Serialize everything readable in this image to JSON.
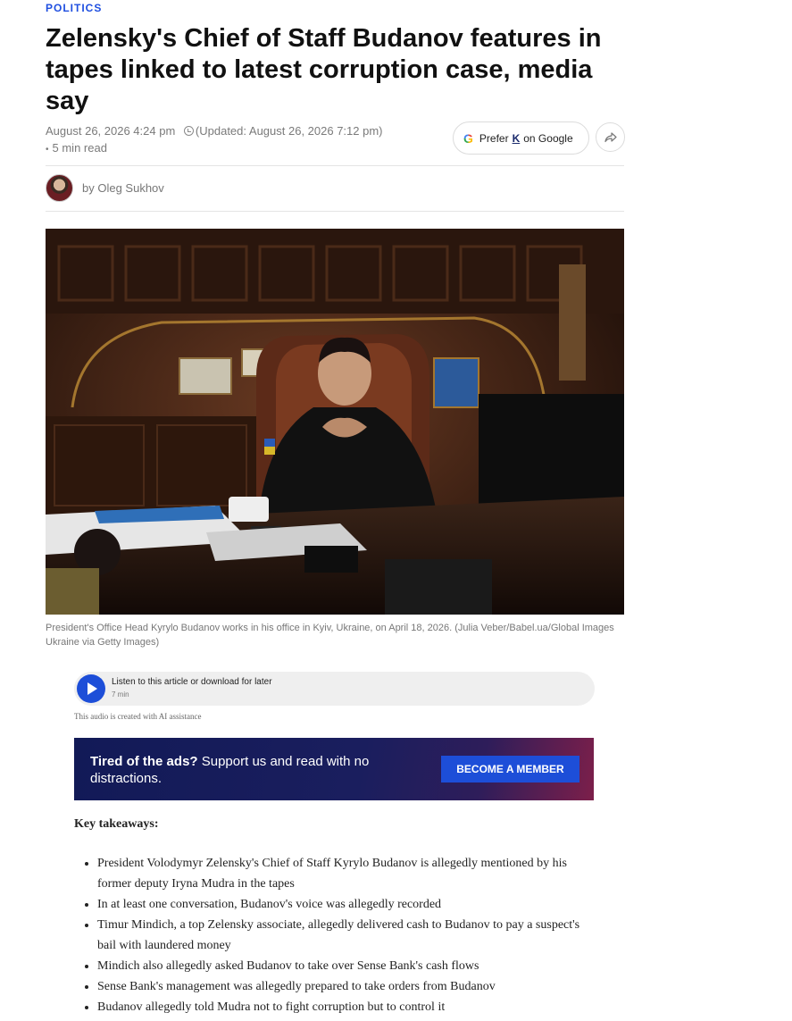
{
  "article": {
    "category": "POLITICS",
    "headline": "Zelensky's Chief of Staff Budanov features in tapes linked to latest corruption case, media say",
    "published": "August 26, 2026 4:24 pm",
    "updated_prefix": "(Updated: ",
    "updated": "August 26, 2026 7:12 pm)",
    "read_time": "5 min read",
    "author": "by Oleg Sukhov",
    "caption": "President's Office Head Kyrylo Budanov works in his office in Kyiv, Ukraine, on April 18, 2026. (Julia Veber/Babel.ua/Global Images Ukraine via Getty Images)"
  },
  "prefer_button": {
    "icon": "google-g-icon",
    "prefix": "Prefer",
    "logo_letter": "K",
    "suffix": "on Google"
  },
  "share": {
    "icon": "share-arrow-icon"
  },
  "audio": {
    "title": "Listen to this article or download for later",
    "duration": "7 min",
    "note": "This audio is created with AI assistance"
  },
  "banner": {
    "bold": "Tired of the ads?",
    "text": " Support us and read with no distractions.",
    "button": "BECOME A MEMBER"
  },
  "key_takeaways": {
    "heading": "Key takeaways:",
    "items": [
      "President Volodymyr Zelensky's Chief of Staff Kyrylo Budanov is allegedly mentioned by his former deputy Iryna Mudra in the tapes",
      "In at least one conversation, Budanov's voice was allegedly recorded",
      "Timur Mindich, a top Zelensky associate, allegedly delivered cash to Budanov to pay a suspect's bail with laundered money",
      "Mindich also allegedly asked Budanov to take over Sense Bank's cash flows",
      "Sense Bank's management was allegedly prepared to take orders from Budanov",
      "Budanov allegedly told Mudra not to fight corruption but to control it"
    ]
  },
  "colors": {
    "accent": "#1d4ed8",
    "category": "#1f4fe0"
  }
}
